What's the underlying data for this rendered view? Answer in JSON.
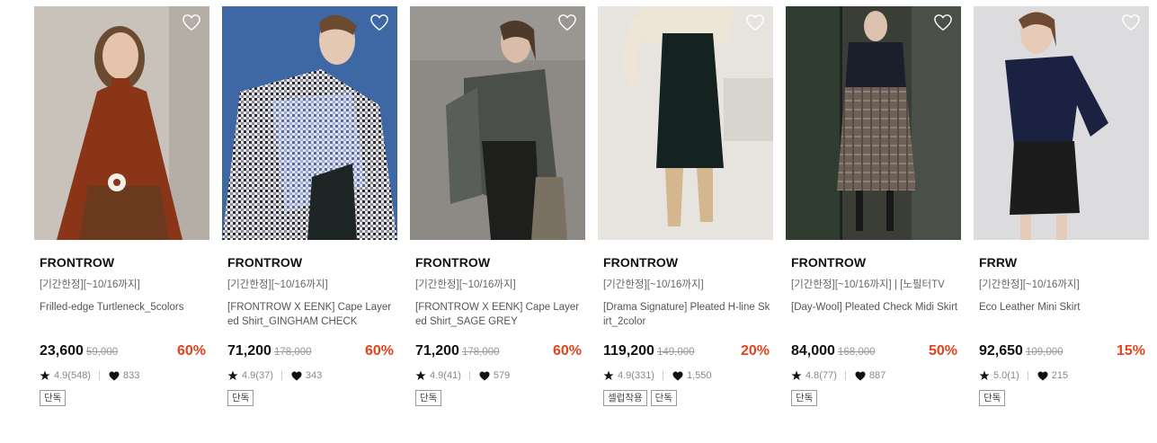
{
  "products": [
    {
      "brand": "FRONTROW",
      "promo": "[기간한정][~10/16까지]",
      "name": "Frilled-edge Turtleneck_5colors",
      "price": "23,600",
      "original": "59,000",
      "discount": "60%",
      "rating": "4.9(548)",
      "likes": "833",
      "tags": [
        "단독"
      ],
      "icons": {
        "wish": "heart-outline-icon",
        "rating": "star-icon",
        "likes": "heart-filled-icon"
      }
    },
    {
      "brand": "FRONTROW",
      "promo": "[기간한정][~10/16까지]",
      "name": "[FRONTROW X EENK] Cape Layered Shirt_GINGHAM CHECK",
      "price": "71,200",
      "original": "178,000",
      "discount": "60%",
      "rating": "4.9(37)",
      "likes": "343",
      "tags": [
        "단독"
      ]
    },
    {
      "brand": "FRONTROW",
      "promo": "[기간한정][~10/16까지]",
      "name": "[FRONTROW X EENK] Cape Layered Shirt_SAGE GREY",
      "price": "71,200",
      "original": "178,000",
      "discount": "60%",
      "rating": "4.9(41)",
      "likes": "579",
      "tags": [
        "단독"
      ]
    },
    {
      "brand": "FRONTROW",
      "promo": "[기간한정][~10/16까지]",
      "name": "[Drama Signature] Pleated H-line Skirt_2color",
      "price": "119,200",
      "original": "149,000",
      "discount": "20%",
      "rating": "4.9(331)",
      "likes": "1,550",
      "tags": [
        "셀럽착용",
        "단독"
      ]
    },
    {
      "brand": "FRONTROW",
      "promo": "[기간한정][~10/16까지] | [노필터TV",
      "name": "[Day-Wool] Pleated Check Midi Skirt",
      "price": "84,000",
      "original": "168,000",
      "discount": "50%",
      "rating": "4.8(77)",
      "likes": "887",
      "tags": [
        "단독"
      ]
    },
    {
      "brand": "FRRW",
      "promo": "[기간한정][~10/16까지]",
      "name": "Eco Leather Mini Skirt",
      "price": "92,650",
      "original": "109,000",
      "discount": "15%",
      "rating": "5.0(1)",
      "likes": "215",
      "tags": [
        "단독"
      ]
    }
  ],
  "colors": {
    "discount": "#e8421b",
    "text": "#111111",
    "muted": "#888888"
  }
}
